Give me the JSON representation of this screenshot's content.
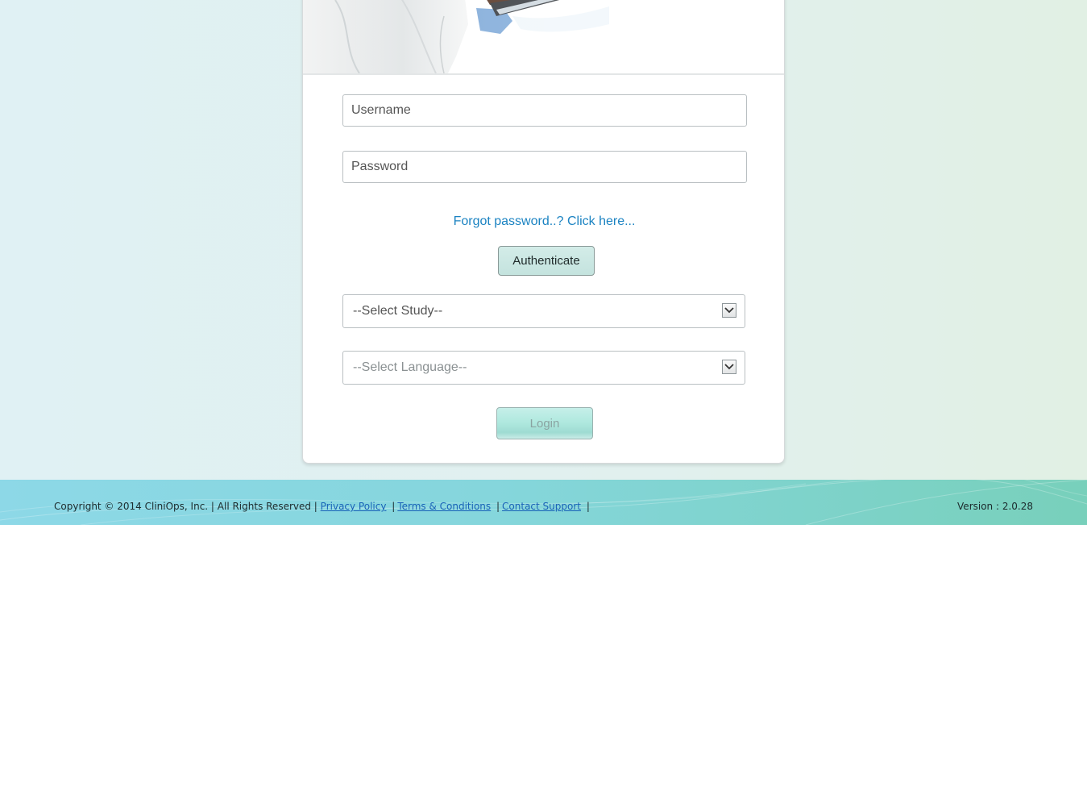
{
  "login": {
    "username_placeholder": "Username",
    "password_placeholder": "Password",
    "forgot_link": "Forgot password..? Click here...",
    "authenticate_label": "Authenticate",
    "study_select": "--Select Study--",
    "language_select": "--Select Language--",
    "login_label": "Login"
  },
  "footer": {
    "copyright": "Copyright © 2014 CliniOps, Inc. | All Rights Reserved |",
    "privacy_link": "Privacy Policy",
    "terms_link": "Terms & Conditions",
    "support_link": "Contact Support",
    "separator": "|",
    "version": "Version : 2.0.28"
  },
  "colors": {
    "link": "#1b83c2",
    "footer_link": "#1a63b8",
    "button_bg": "#c4e3de",
    "footer_gradient_start": "#8dd8e7",
    "footer_gradient_end": "#78d0bb"
  },
  "icons": {
    "hero": "doctor-with-tablet-image",
    "dropdown": "chevron-down-icon"
  }
}
